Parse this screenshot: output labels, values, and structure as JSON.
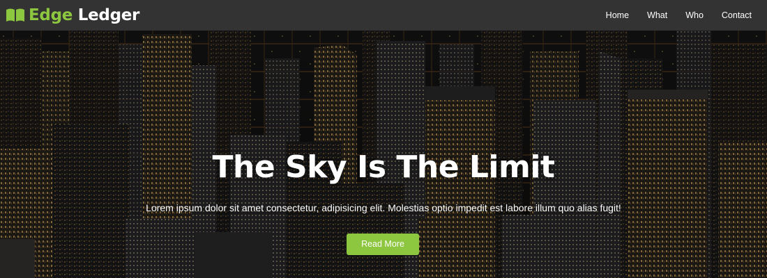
{
  "brand": {
    "accent_word": "Edge",
    "rest_word": "Ledger",
    "icon": "open-book-icon",
    "accent_color": "#8dc63f"
  },
  "nav": {
    "items": [
      {
        "label": "Home"
      },
      {
        "label": "What"
      },
      {
        "label": "Who"
      },
      {
        "label": "Contact"
      }
    ]
  },
  "hero": {
    "title": "The Sky Is The Limit",
    "subtitle": "Lorem ipsum dolor sit amet consectetur, adipisicing elit. Molestias optio impedit est labore illum quo alias fugit!",
    "button_label": "Read More",
    "background": "city-skyline-night-image",
    "button_color": "#8dc63f"
  }
}
